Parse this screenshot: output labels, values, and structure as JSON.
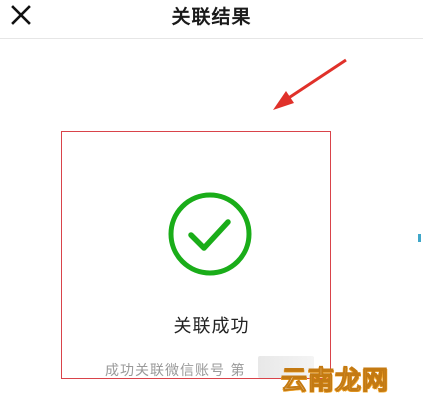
{
  "navbar": {
    "title": "关联结果",
    "close_icon": "close-icon"
  },
  "result": {
    "icon": "check-circle-icon",
    "status_color": "#1aad19",
    "title": "关联成功",
    "subtitle": "成功关联微信账号",
    "account_masked_prefix": "第"
  },
  "annotation": {
    "box_color": "#d9434a",
    "arrow_color": "#e0312a"
  },
  "watermark": {
    "text": "云南龙网"
  }
}
